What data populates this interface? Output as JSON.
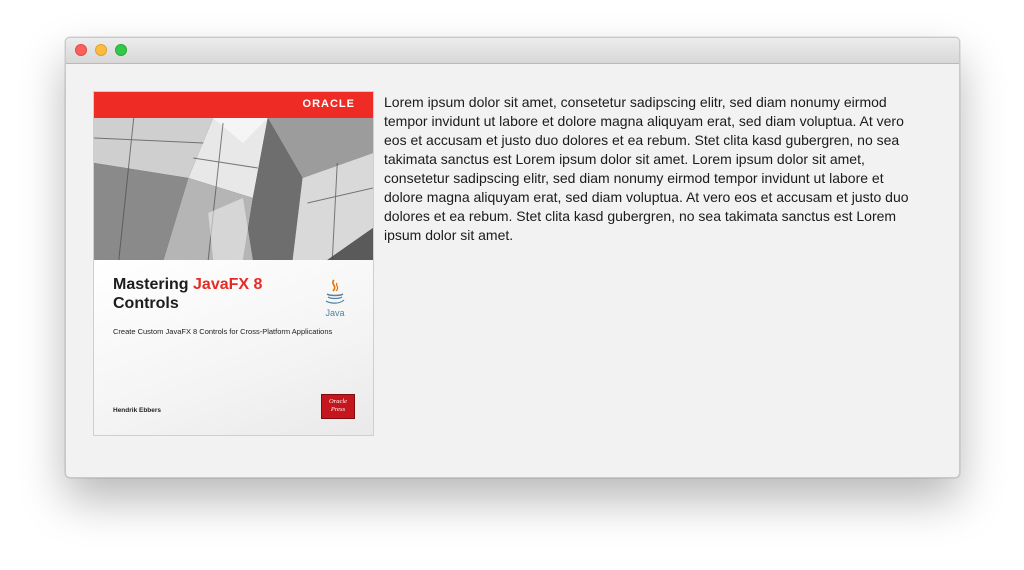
{
  "window": {
    "controls": [
      "close",
      "minimize",
      "zoom"
    ],
    "colors": {
      "close": "#fc605c",
      "minimize": "#fdbc40",
      "zoom": "#34c84a"
    }
  },
  "book": {
    "publisher_logo": "ORACLE",
    "title_part1": "Mastering ",
    "title_accent": "JavaFX 8",
    "title_part2": "Controls",
    "subtitle": "Create Custom JavaFX 8 Controls for Cross-Platform Applications",
    "author": "Hendrik Ebbers",
    "java_logo": "Java",
    "press_badge_line1": "Oracle",
    "press_badge_line2": "Press",
    "accent_color": "#e52b25"
  },
  "content": {
    "paragraph": "Lorem ipsum dolor sit amet, consetetur sadipscing elitr, sed diam nonumy eirmod tempor invidunt ut labore et dolore magna aliquyam erat, sed diam voluptua. At vero eos et accusam et justo duo dolores et ea rebum. Stet clita kasd gubergren, no sea takimata sanctus est Lorem ipsum dolor sit amet. Lorem ipsum dolor sit amet, consetetur sadipscing elitr, sed diam nonumy eirmod tempor invidunt ut labore et dolore magna aliquyam erat, sed diam voluptua. At vero eos et accusam et justo duo dolores et ea rebum. Stet clita kasd gubergren, no sea takimata sanctus est Lorem ipsum dolor sit amet."
  }
}
